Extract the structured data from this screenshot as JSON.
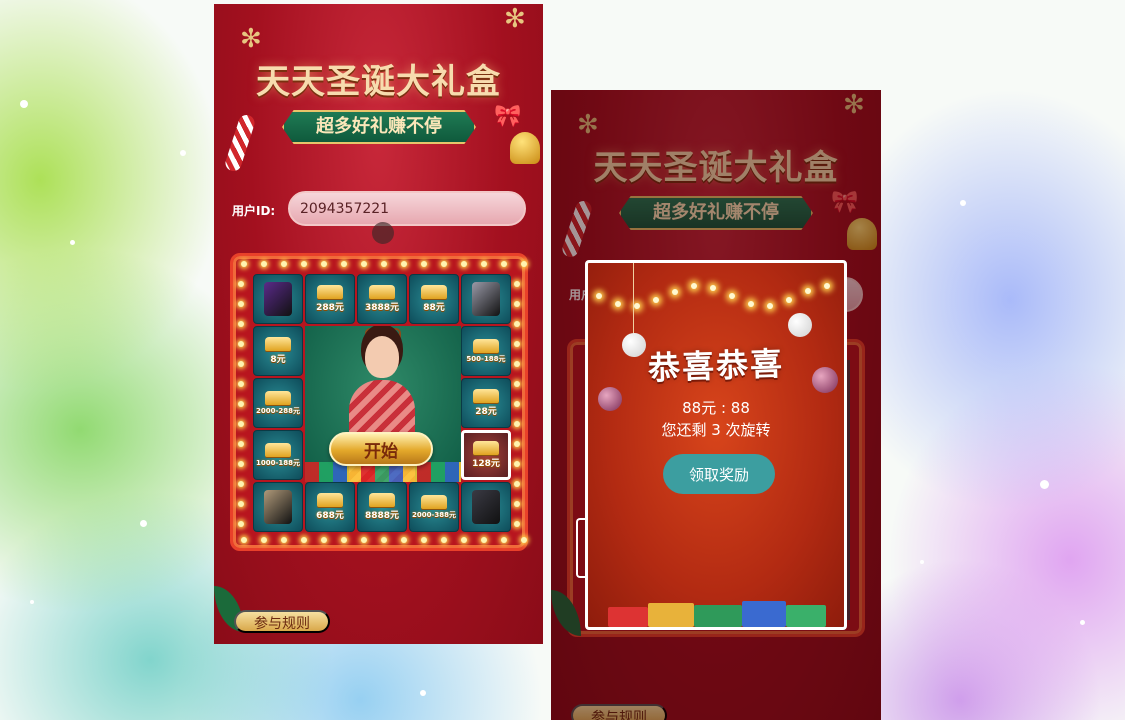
{
  "screen1": {
    "title": "天天圣诞大礼盒",
    "subtitle": "超多好礼赚不停",
    "uid_label": "用户ID:",
    "uid_value": "2094357221",
    "start_label": "开始",
    "rules_label": "参与规则",
    "prizes": [
      {
        "label": "",
        "kind": "product"
      },
      {
        "label": "288元",
        "kind": "gold"
      },
      {
        "label": "3888元",
        "kind": "gold"
      },
      {
        "label": "88元",
        "kind": "gold"
      },
      {
        "label": "",
        "kind": "product"
      },
      {
        "label": "500-188元",
        "kind": "gold"
      },
      {
        "label": "28元",
        "kind": "gold"
      },
      {
        "label": "128元",
        "kind": "gold",
        "active": true
      },
      {
        "label": "",
        "kind": "product"
      },
      {
        "label": "2000-388元",
        "kind": "gold"
      },
      {
        "label": "8888元",
        "kind": "gold"
      },
      {
        "label": "688元",
        "kind": "gold"
      },
      {
        "label": "",
        "kind": "product"
      },
      {
        "label": "1000-188元",
        "kind": "gold"
      },
      {
        "label": "2000-288元",
        "kind": "gold"
      },
      {
        "label": "8元",
        "kind": "gold"
      }
    ]
  },
  "screen2": {
    "title": "天天圣诞大礼盒",
    "subtitle": "超多好礼赚不停",
    "uid_label": "用户ID:",
    "rules_label": "参与规则"
  },
  "modal": {
    "heading": "恭喜恭喜",
    "prize_text": "88元 : 88",
    "remaining_text": "您还剩 3 次旋转",
    "claim_label": "领取奖励"
  },
  "colors": {
    "page_red": "#a3101f",
    "tile_teal": "#0e4c5a",
    "gold": "#e0a320",
    "claim_button": "#3c9ea0"
  }
}
